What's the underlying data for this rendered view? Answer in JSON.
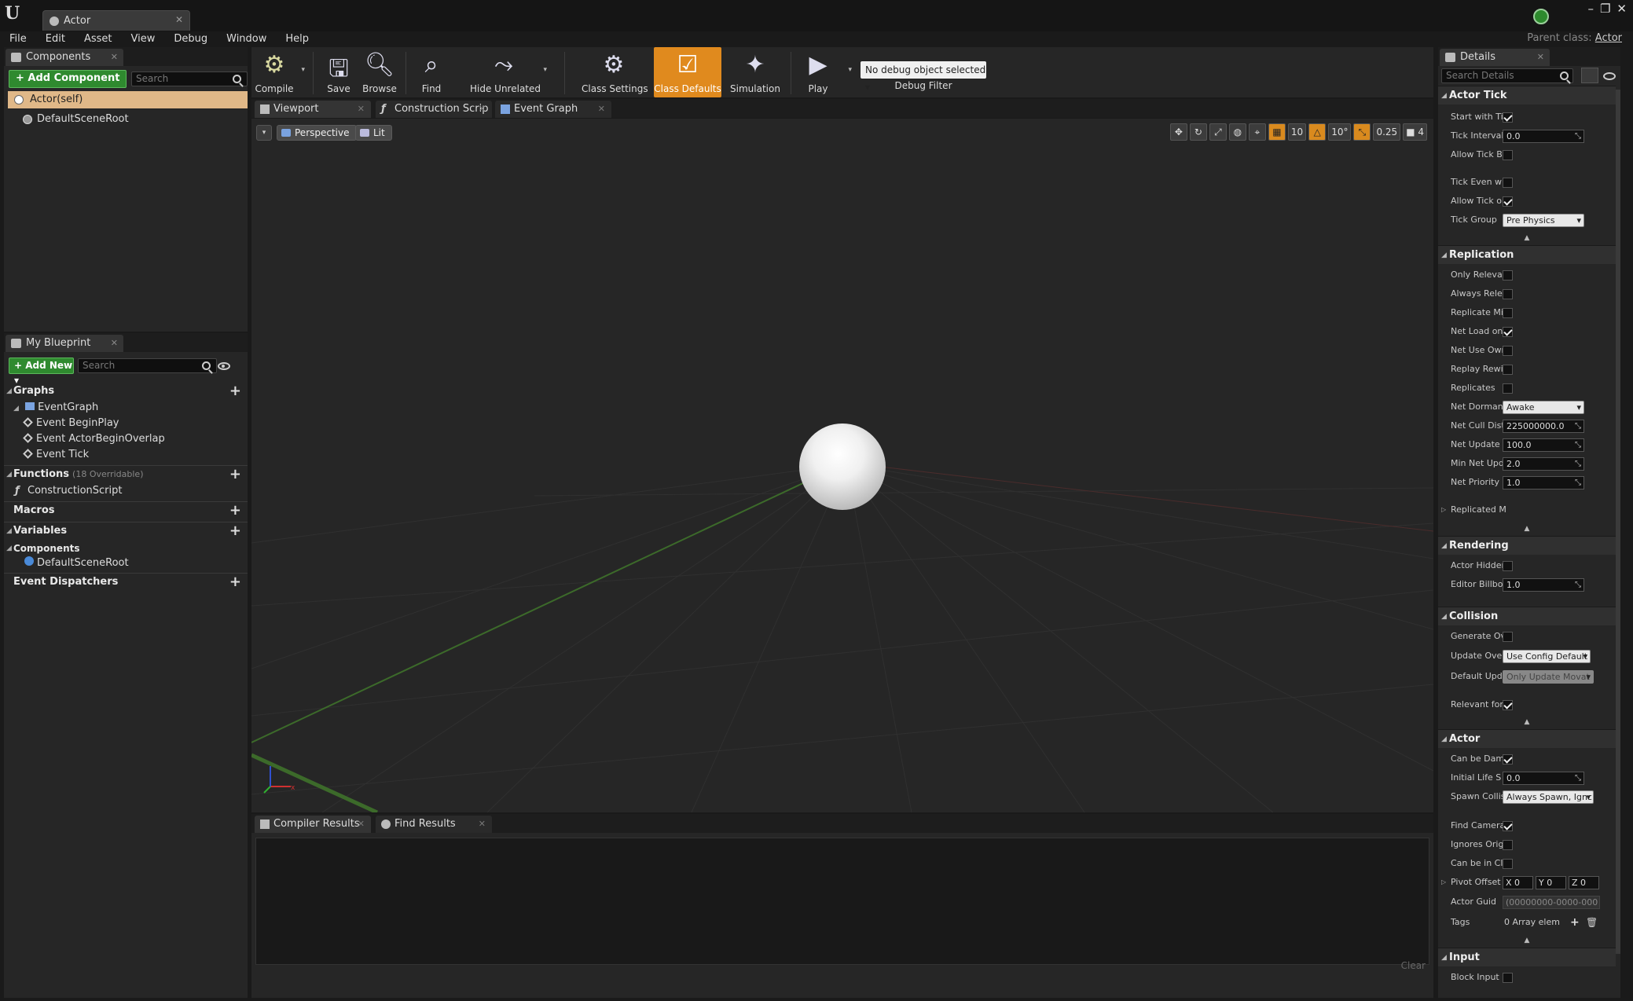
{
  "window": {
    "tab_title": "Actor",
    "parent_class_label": "Parent class:",
    "parent_class_value": "Actor"
  },
  "menu": [
    "File",
    "Edit",
    "Asset",
    "View",
    "Debug",
    "Window",
    "Help"
  ],
  "components": {
    "tab": "Components",
    "add_button": "+ Add Component ▾",
    "search_placeholder": "Search",
    "root": "Actor(self)",
    "child": "DefaultSceneRoot"
  },
  "my_blueprint": {
    "tab": "My Blueprint",
    "add_button": "+ Add New ▾",
    "search_placeholder": "Search",
    "graphs_label": "Graphs",
    "event_graph": "EventGraph",
    "events": [
      "Event BeginPlay",
      "Event ActorBeginOverlap",
      "Event Tick"
    ],
    "functions_label": "Functions",
    "functions_sub": "(18 Overridable)",
    "construction_script": "ConstructionScript",
    "macros_label": "Macros",
    "variables_label": "Variables",
    "components_label": "Components",
    "component_var": "DefaultSceneRoot",
    "dispatchers_label": "Event Dispatchers"
  },
  "toolbar": {
    "compile": "Compile",
    "save": "Save",
    "browse": "Browse",
    "find": "Find",
    "hide_unrelated": "Hide Unrelated",
    "class_settings": "Class Settings",
    "class_defaults": "Class Defaults",
    "simulation": "Simulation",
    "play": "Play",
    "debug_select": "No debug object selected ▾",
    "debug_label": "Debug Filter"
  },
  "center_tabs": [
    "Viewport",
    "Construction Scrip",
    "Event Graph"
  ],
  "viewport": {
    "perspective": "Perspective",
    "lit": "Lit",
    "grid_snap": "10",
    "rot_snap": "10°",
    "scale_snap": "0.25",
    "camera_speed": "4"
  },
  "bottom_tabs": [
    "Compiler Results",
    "Find Results"
  ],
  "bottom": {
    "clear": "Clear"
  },
  "details": {
    "tab": "Details",
    "search_placeholder": "Search Details",
    "actor_tick": {
      "title": "Actor Tick",
      "start_with_tick": "Start with Ti",
      "tick_interval": "Tick Interval",
      "tick_interval_value": "0.0",
      "allow_tick_before": "Allow Tick B",
      "tick_even_when": "Tick Even wl",
      "allow_tick_on": "Allow Tick o",
      "tick_group": "Tick Group",
      "tick_group_value": "Pre Physics"
    },
    "replication": {
      "title": "Replication",
      "only_relevant": "Only Relevai",
      "always_relevant": "Always Rele",
      "replicate_movement": "Replicate Mi",
      "net_load": "Net Load on",
      "net_use_owner": "Net Use Owr",
      "replay_rewind": "Replay Rewi",
      "replicates": "Replicates",
      "net_dormancy": "Net Dormani",
      "net_dormancy_value": "Awake",
      "net_cull": "Net Cull Dist",
      "net_cull_value": "225000000.0",
      "net_update": "Net Update F",
      "net_update_value": "100.0",
      "min_net_update": "Min Net Upd",
      "min_net_update_value": "2.0",
      "net_priority": "Net Priority",
      "net_priority_value": "1.0",
      "replicated_more": "Replicated M"
    },
    "rendering": {
      "title": "Rendering",
      "actor_hidden": "Actor Hidder",
      "editor_billboard": "Editor Billbo",
      "editor_billboard_value": "1.0"
    },
    "collision": {
      "title": "Collision",
      "generate_overlap": "Generate Ov",
      "update_overlap": "Update Over",
      "update_overlap_value": "Use Config Default",
      "default_update": "Default Upda",
      "default_update_value": "Only Update Movat",
      "relevant_for": "Relevant for"
    },
    "actor": {
      "title": "Actor",
      "can_be_damaged": "Can be Dam",
      "initial_life": "Initial Life S",
      "initial_life_value": "0.0",
      "spawn_collision": "Spawn Collis",
      "spawn_collision_value": "Always Spawn, Ignc",
      "find_camera": "Find Camera",
      "ignores_origin": "Ignores Orig",
      "can_be_in_cluster": "Can be in Cl",
      "pivot_offset": "Pivot Offset",
      "pivot_x": "X 0",
      "pivot_y": "Y 0",
      "pivot_z": "Z 0",
      "actor_guid": "Actor Guid",
      "actor_guid_value": "(00000000-0000-000",
      "tags": "Tags",
      "tags_value": "0 Array elem"
    },
    "input": {
      "title": "Input",
      "block_input": "Block Input"
    }
  }
}
